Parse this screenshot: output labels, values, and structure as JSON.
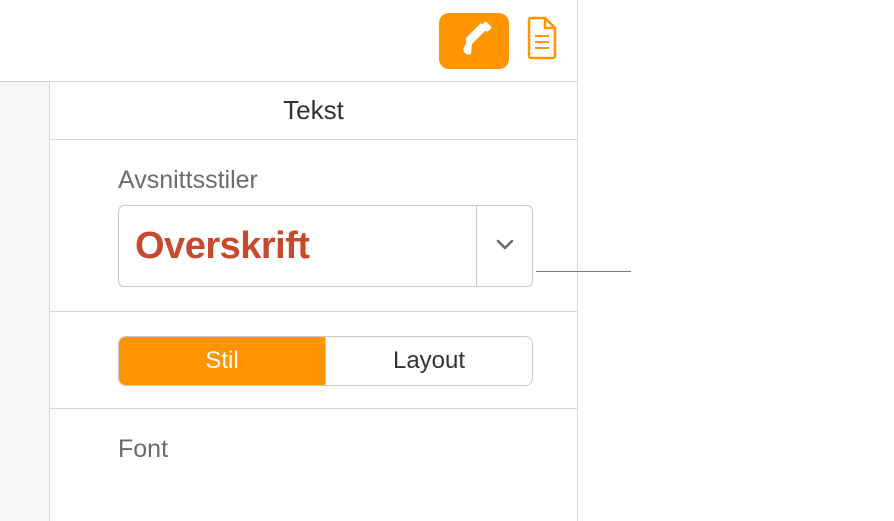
{
  "toolbar": {
    "format_icon": "brush",
    "document_icon": "document"
  },
  "inspector": {
    "header": "Tekst",
    "paragraph_styles": {
      "label": "Avsnittsstiler",
      "selected": "Overskrift"
    },
    "tabs": {
      "style": "Stil",
      "layout": "Layout"
    },
    "font": {
      "label": "Font"
    }
  },
  "colors": {
    "accent": "#ff9500",
    "heading_style": "#c84a2e"
  }
}
